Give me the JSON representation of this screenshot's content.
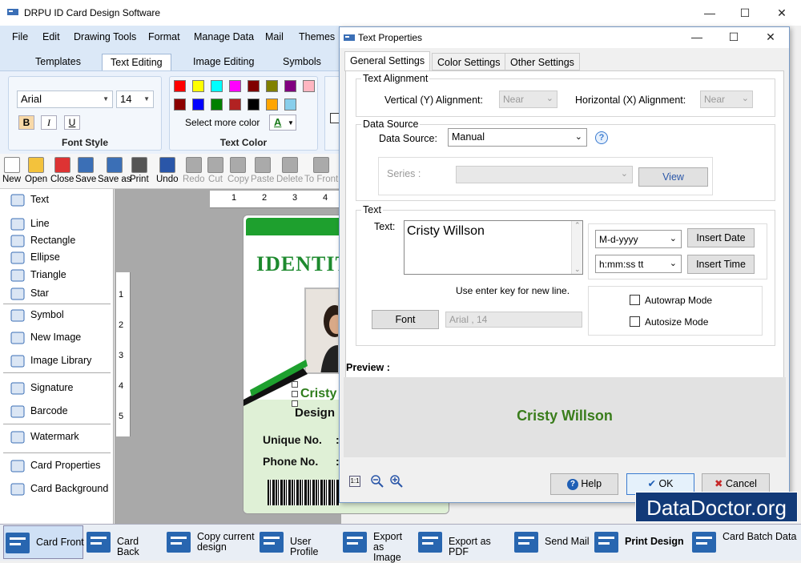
{
  "app": {
    "title": "DRPU ID Card Design Software",
    "win_min": "—",
    "win_max": "☐",
    "win_close": "✕"
  },
  "menu": [
    "File",
    "Edit",
    "Drawing Tools",
    "Format",
    "Manage Data",
    "Mail",
    "Themes"
  ],
  "ribbon_tabs": [
    "Templates",
    "Text Editing",
    "Image Editing",
    "Symbols"
  ],
  "font_style": {
    "font": "Arial",
    "size": "14",
    "bold": "B",
    "italic": "I",
    "underline": "U",
    "label": "Font Style"
  },
  "text_color": {
    "label": "Text Color",
    "select_more": "Select more color",
    "a_glyph": "A",
    "swatches": [
      "#ff0000",
      "#ffff00",
      "#00ffff",
      "#ff00ff",
      "#800000",
      "#808000",
      "#800080",
      "#ffb6c1",
      "#8b0000",
      "#0000ff",
      "#008000",
      "#b22222",
      "#000000",
      "#ffa500",
      "#87ceeb"
    ]
  },
  "toolbar": [
    "New",
    "Open",
    "Close",
    "Save",
    "Save as",
    "Print",
    "Undo",
    "Redo",
    "Cut",
    "Copy",
    "Paste",
    "Delete",
    "To Front"
  ],
  "left_panel": [
    "Text",
    "Line",
    "Rectangle",
    "Ellipse",
    "Triangle",
    "Star",
    "Symbol",
    "New Image",
    "Image Library",
    "Signature",
    "Barcode",
    "Watermark",
    "Card Properties",
    "Card Background"
  ],
  "ruler_h": [
    "1",
    "2",
    "3",
    "4"
  ],
  "ruler_v": [
    "1",
    "2",
    "3",
    "4",
    "5"
  ],
  "card": {
    "identity": "IDENTIT",
    "name": "Cristy",
    "design": "Design",
    "unique_no": "Unique No.",
    "phone_no": "Phone No.",
    "colon": ":"
  },
  "dialog": {
    "title": "Text Properties",
    "win_min": "—",
    "win_max": "☐",
    "win_close": "✕",
    "tabs": [
      "General Settings",
      "Color Settings",
      "Other Settings"
    ],
    "text_alignment": "Text Alignment",
    "vertical_label": "Vertical (Y) Alignment:",
    "vertical_value": "Near",
    "horizontal_label": "Horizontal (X) Alignment:",
    "horizontal_value": "Near",
    "data_source_group": "Data Source",
    "data_source_label": "Data Source:",
    "data_source_value": "Manual",
    "help_glyph": "?",
    "series_label": "Series :",
    "view": "View",
    "text_group": "Text",
    "text_label": "Text:",
    "text_value": "Cristy Willson",
    "date_format": "M-d-yyyy",
    "insert_date": "Insert Date",
    "time_format": "h:mm:ss tt",
    "insert_time": "Insert Time",
    "enter_hint": "Use enter key for new line.",
    "autowrap": "Autowrap Mode",
    "autosize": "Autosize Mode",
    "font_button": "Font",
    "font_value": "Arial , 14",
    "preview_label": "Preview :",
    "preview_text": "Cristy Willson",
    "help": "Help",
    "ok": "OK",
    "cancel": "Cancel",
    "zoom_fit": "1:1"
  },
  "taskbar": [
    "Card Front",
    "Card Back",
    "Copy current design",
    "User Profile",
    "Export as Image",
    "Export as PDF",
    "Send Mail",
    "Print Design",
    "Card Batch Data"
  ],
  "watermark": "DataDoctor.org",
  "colors": {
    "green": "#1d8a2e",
    "preview_green": "#3a7d1c",
    "taskbar_icon": "#2866b0"
  }
}
